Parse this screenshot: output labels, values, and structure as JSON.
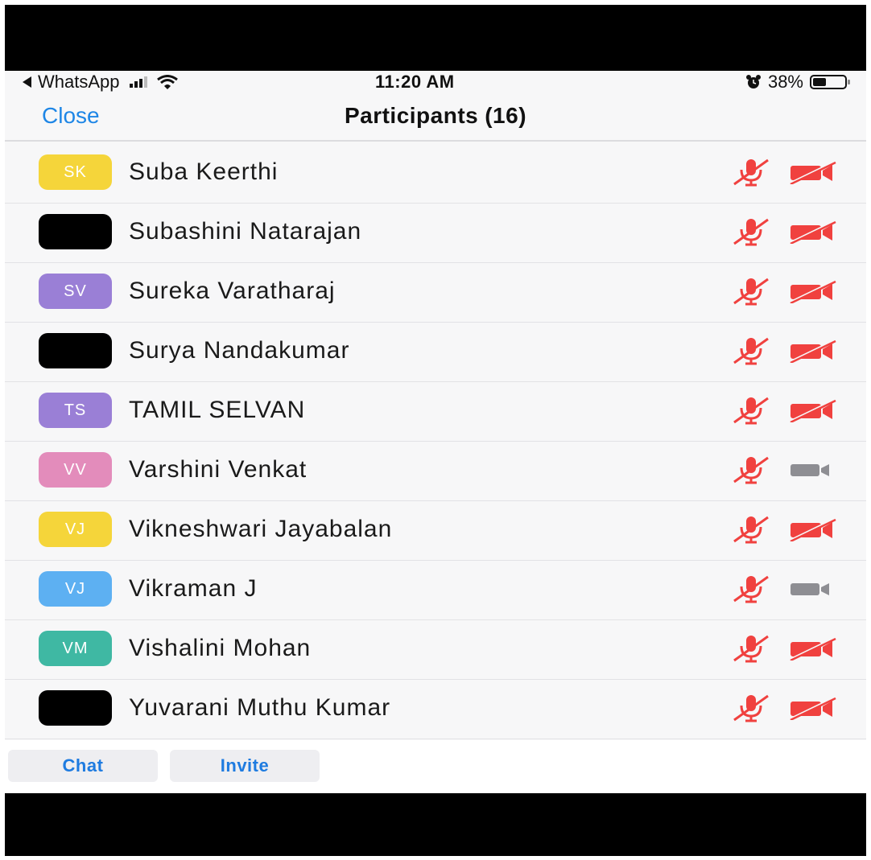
{
  "status_bar": {
    "back_app": "WhatsApp",
    "time": "11:20 AM",
    "battery_text": "38%",
    "battery_level": 0.38
  },
  "nav": {
    "close_label": "Close",
    "title": "Participants",
    "count": "(16)"
  },
  "participants": [
    {
      "initials": "SK",
      "name": "Suba Keerthi",
      "avatar_color": "#f5d53a",
      "mic": "muted",
      "video": "off"
    },
    {
      "initials": "",
      "name": "Subashini Natarajan",
      "avatar_color": "#000000",
      "mic": "muted",
      "video": "off"
    },
    {
      "initials": "SV",
      "name": "Sureka Varatharaj",
      "avatar_color": "#9a7fd6",
      "mic": "muted",
      "video": "off"
    },
    {
      "initials": "",
      "name": "Surya Nandakumar",
      "avatar_color": "#000000",
      "mic": "muted",
      "video": "off"
    },
    {
      "initials": "TS",
      "name": "TAMIL SELVAN",
      "avatar_color": "#9a7fd6",
      "mic": "muted",
      "video": "off"
    },
    {
      "initials": "VV",
      "name": "Varshini Venkat",
      "avatar_color": "#e38cbb",
      "mic": "muted",
      "video": "on"
    },
    {
      "initials": "VJ",
      "name": "Vikneshwari Jayabalan",
      "avatar_color": "#f5d53a",
      "mic": "muted",
      "video": "off"
    },
    {
      "initials": "VJ",
      "name": "Vikraman J",
      "avatar_color": "#5db0f2",
      "mic": "muted",
      "video": "on"
    },
    {
      "initials": "VM",
      "name": "Vishalini Mohan",
      "avatar_color": "#3fb8a3",
      "mic": "muted",
      "video": "off"
    },
    {
      "initials": "",
      "name": "Yuvarani Muthu Kumar",
      "avatar_color": "#000000",
      "mic": "muted",
      "video": "off"
    }
  ],
  "bottom": {
    "chat_label": "Chat",
    "invite_label": "Invite"
  },
  "colors": {
    "accent": "#1e86e6",
    "muted_red": "#f0413f",
    "video_on_gray": "#8e8e93"
  },
  "icons": {
    "mic_muted": "mic-muted-icon",
    "video_off": "video-off-icon",
    "video_on": "video-camera-icon"
  }
}
